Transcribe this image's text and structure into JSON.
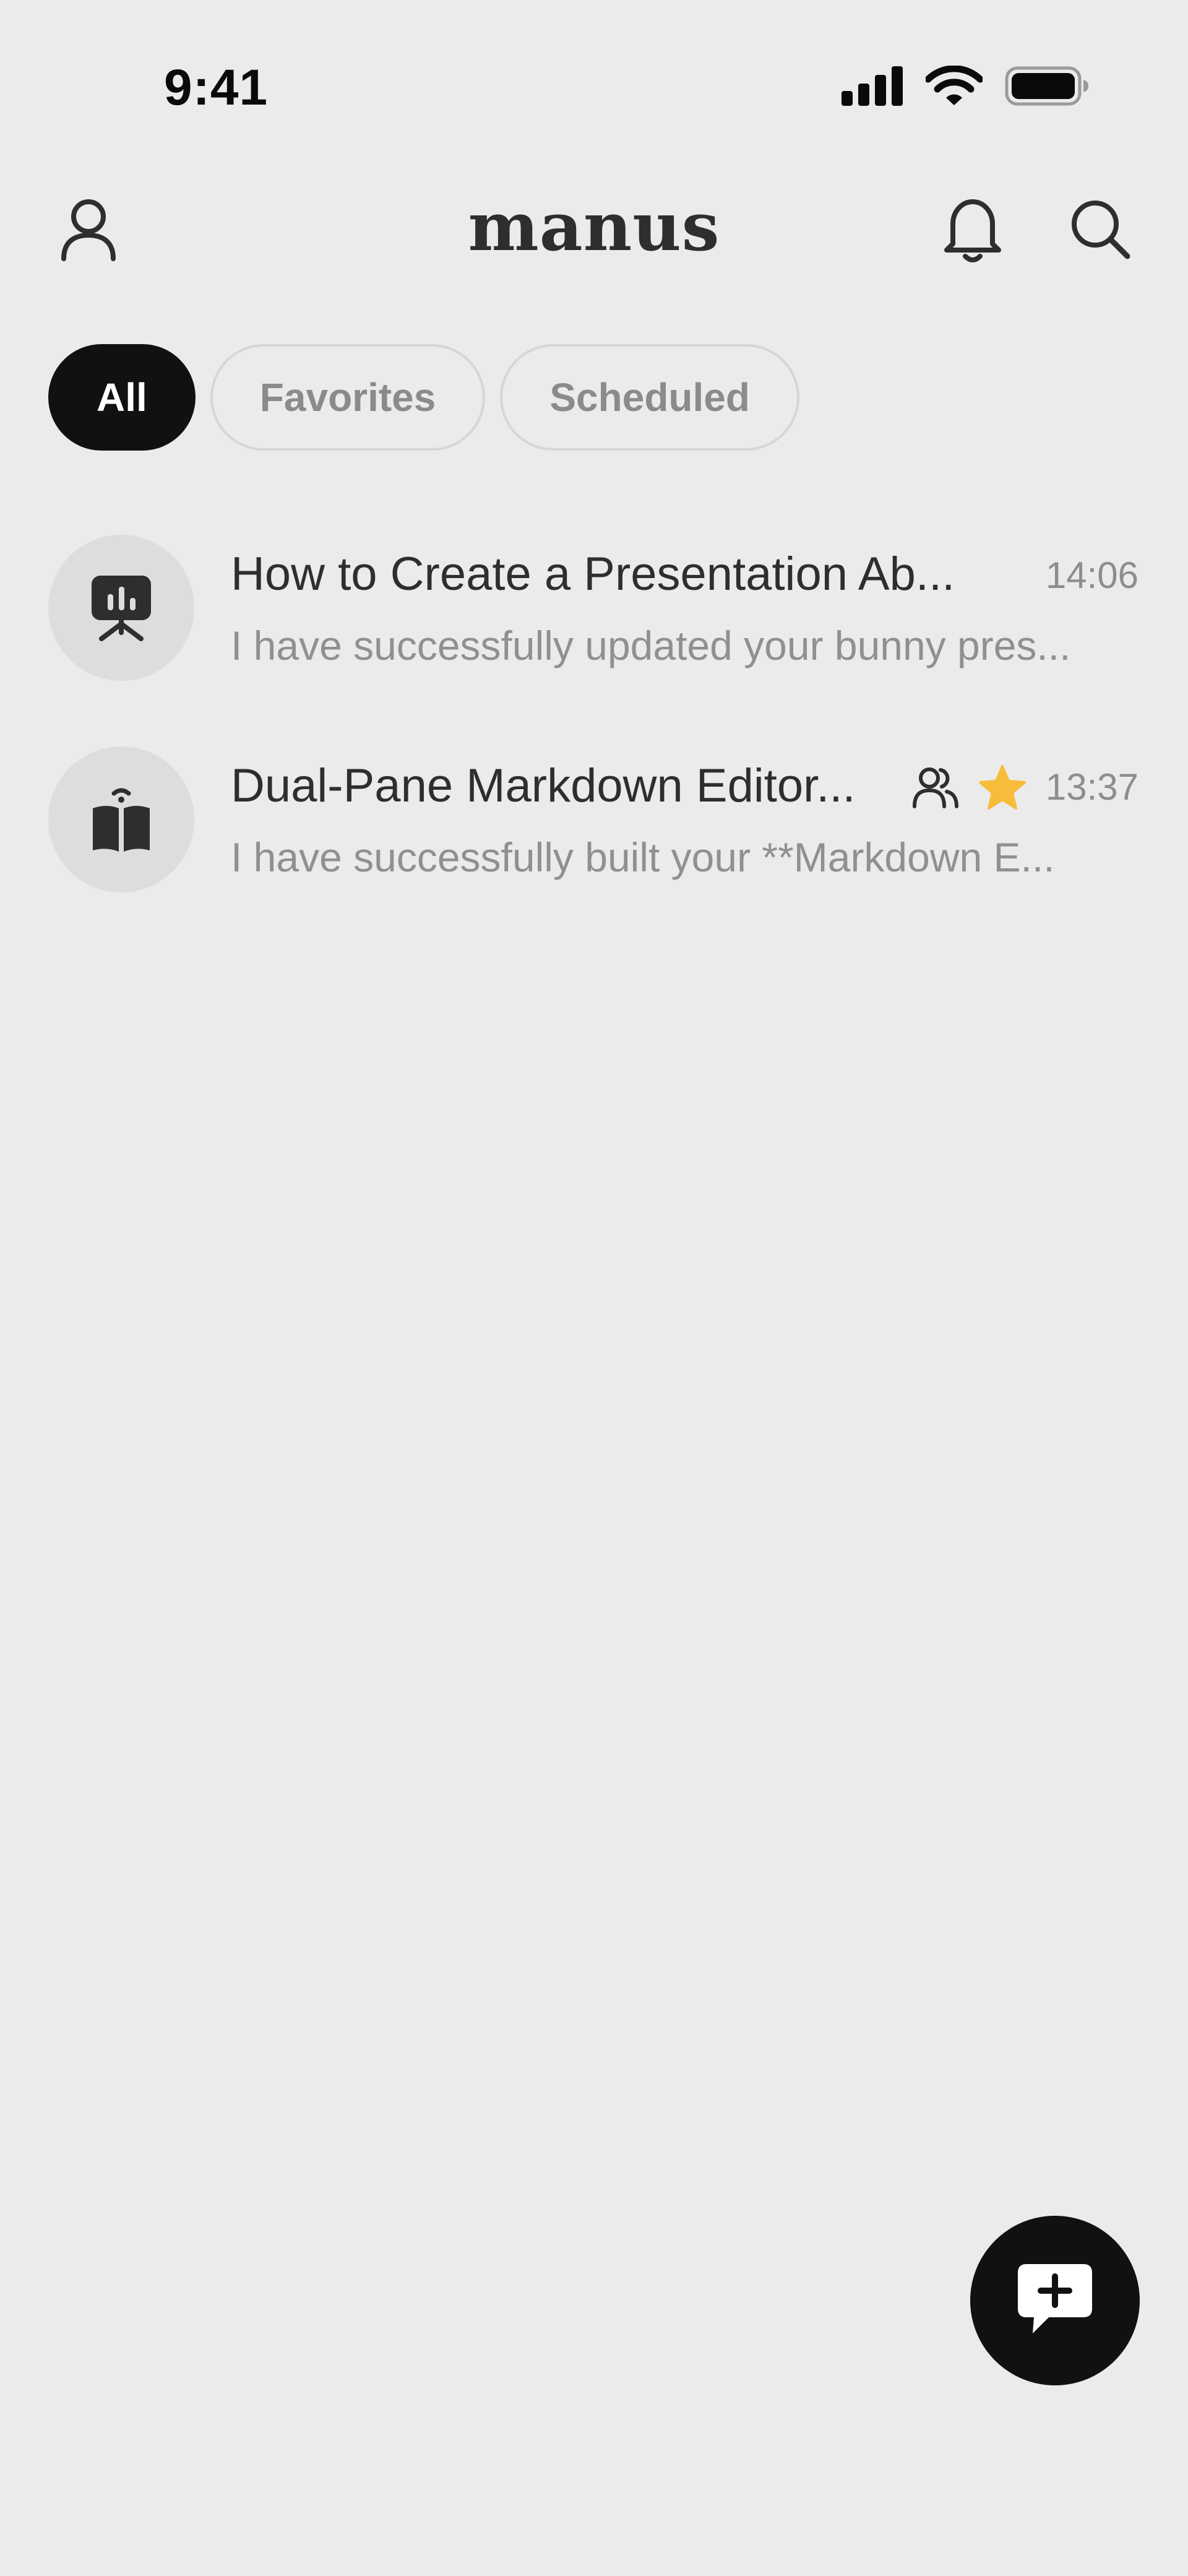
{
  "status_bar": {
    "time": "9:41"
  },
  "header": {
    "brand": "manus"
  },
  "tabs": [
    {
      "label": "All",
      "active": true
    },
    {
      "label": "Favorites",
      "active": false
    },
    {
      "label": "Scheduled",
      "active": false
    }
  ],
  "tasks": [
    {
      "icon": "presentation-icon",
      "title": "How to Create a Presentation Ab...",
      "time": "14:06",
      "preview": "I have successfully updated your bunny pres...",
      "shared": false,
      "favorite": false
    },
    {
      "icon": "book-icon",
      "title": "Dual-Pane Markdown Editor...",
      "time": "13:37",
      "preview": "I have successfully built your **Markdown E...",
      "shared": true,
      "favorite": true
    }
  ],
  "colors": {
    "background": "#ebebeb",
    "accent_dark": "#111111",
    "star": "#f7bd3a",
    "muted_text": "#8d8d8d"
  }
}
